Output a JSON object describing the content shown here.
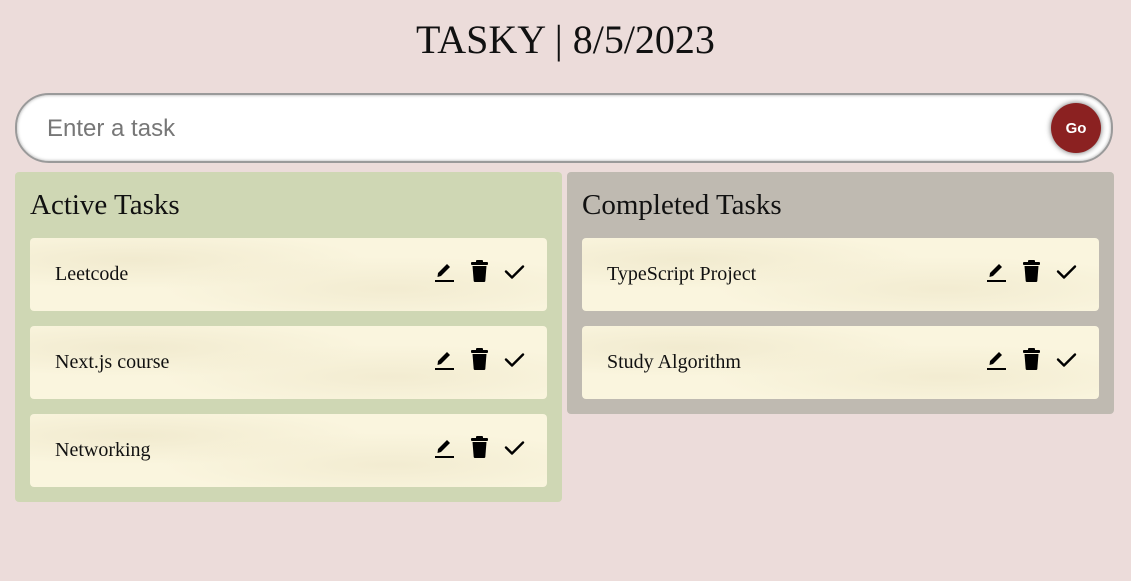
{
  "header": {
    "title": "TASKY | 8/5/2023"
  },
  "input": {
    "placeholder": "Enter a task",
    "value": "",
    "go_label": "Go"
  },
  "colors": {
    "background": "#ecdcda",
    "active_panel": "#cfd7b4",
    "completed_panel": "#bfbab1",
    "card": "#faf5de",
    "go_button": "#8b2121"
  },
  "icons": {
    "edit": "pencil-icon",
    "delete": "trash-icon",
    "done": "check-icon"
  },
  "active": {
    "heading": "Active Tasks",
    "tasks": [
      {
        "label": "Leetcode"
      },
      {
        "label": "Next.js course"
      },
      {
        "label": "Networking"
      }
    ]
  },
  "completed": {
    "heading": "Completed Tasks",
    "tasks": [
      {
        "label": "TypeScript Project"
      },
      {
        "label": "Study Algorithm"
      }
    ]
  }
}
